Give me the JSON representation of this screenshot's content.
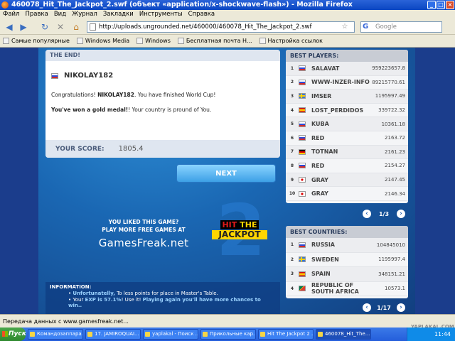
{
  "window": {
    "title": "460078_Hit_The_Jackpot_2.swf (объект «application/x-shockwave-flash») - Mozilla Firefox"
  },
  "menu": [
    "Файл",
    "Правка",
    "Вид",
    "Журнал",
    "Закладки",
    "Инструменты",
    "Справка"
  ],
  "navbar": {
    "url": "http://uploads.ungrounded.net/460000/460078_Hit_The_Jackpot_2.swf",
    "search_placeholder": "Google"
  },
  "bookmarks": [
    "Самые популярные",
    "Windows Media",
    "Windows",
    "Бесплатная почта H...",
    "Настройка ссылок"
  ],
  "game": {
    "end_header": "THE END!",
    "player": "NIKOLAY182",
    "msg_congrats_prefix": "Congratulations!",
    "msg_congrats_name": "NIKOLAY182",
    "msg_congrats_suffix": ". You have finished World Cup!",
    "msg_gold_bold": "You've won a gold medal!",
    "msg_gold_rest": "! Your country is pround of You.",
    "score_label": "YOUR SCORE:",
    "score_value": "1805.4",
    "next_label": "NEXT",
    "promo_line1": "YOU LIKED THIS GAME?",
    "promo_line2": "PLAY MORE FREE GAMES AT",
    "promo_site": "GamesFreak.net",
    "logo_number": "2",
    "logo_hit": "HIT",
    "logo_the": "THE",
    "logo_jackpot": "JACKPOT",
    "info_title": "INFORMATION:",
    "info_1_bold": "Unfortunatelly,",
    "info_1_rest": " To less points for place in Master's Table.",
    "info_2_pre": "Your ",
    "info_2_exp": "EXP is 57.1%",
    "info_2_mid": "! Use it! ",
    "info_2_bold": "Playing again you'll have more chances to win..",
    "best_players_header": "BEST PLAYERS:",
    "best_players": [
      {
        "rank": "1",
        "flag": "ru",
        "name": "SALAVAT",
        "score": "959223657.8"
      },
      {
        "rank": "2",
        "flag": "ru",
        "name": "WWW-INZER-INFO",
        "score": "89215770.61"
      },
      {
        "rank": "3",
        "flag": "se",
        "name": "IMSER",
        "score": "1195997.49"
      },
      {
        "rank": "4",
        "flag": "es",
        "name": "LOST_PERDIDOS",
        "score": "339722.32"
      },
      {
        "rank": "5",
        "flag": "ru",
        "name": "KUBA",
        "score": "10361.18"
      },
      {
        "rank": "6",
        "flag": "ru",
        "name": "RED",
        "score": "2163.72"
      },
      {
        "rank": "7",
        "flag": "de",
        "name": "TOTNAN",
        "score": "2161.23"
      },
      {
        "rank": "8",
        "flag": "ru",
        "name": "RED",
        "score": "2154.27"
      },
      {
        "rank": "9",
        "flag": "jp",
        "name": "GRAY",
        "score": "2147.45"
      },
      {
        "rank": "10",
        "flag": "jp",
        "name": "GRAY",
        "score": "2146.34"
      }
    ],
    "players_page": "1/3",
    "best_countries_header": "BEST COUNTRIES:",
    "best_countries": [
      {
        "rank": "1",
        "flag": "ru",
        "name": "RUSSIA",
        "score": "104845010"
      },
      {
        "rank": "2",
        "flag": "se",
        "name": "SWEDEN",
        "score": "1195997.4"
      },
      {
        "rank": "3",
        "flag": "es",
        "name": "SPAIN",
        "score": "348151.21"
      },
      {
        "rank": "4",
        "flag": "za",
        "name": "REPUBLIC OF SOUTH AFRICA",
        "score": "10573.1"
      }
    ],
    "countries_page": "1/17"
  },
  "status": {
    "text": "Передача данных с www.gamesfreak.net...",
    "watermark": "YAPLAKAL.COM"
  },
  "taskbar": {
    "start": "Пуск",
    "tasks": [
      "Командозаппара...",
      "17. JAMIROQUAI...",
      "yaplakal - Поиск ...",
      "Прикольные кар...",
      "Hit The Jackpot 2 ...",
      "460078_Hit_The..."
    ],
    "clock": "11:44"
  }
}
